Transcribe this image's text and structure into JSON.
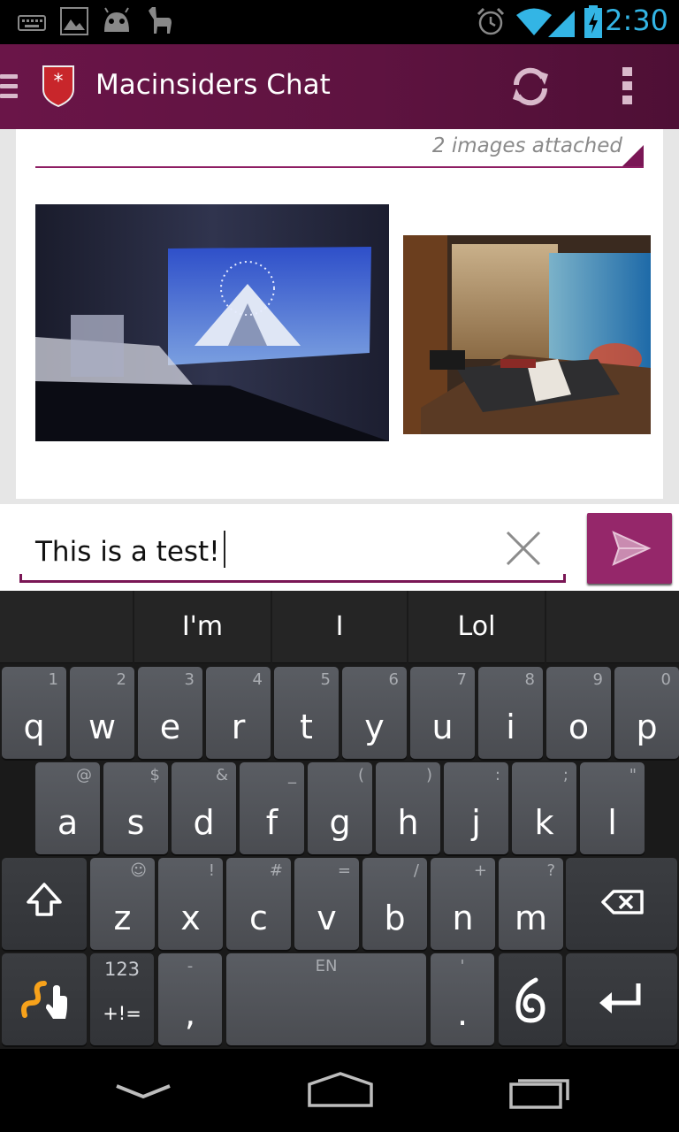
{
  "status_bar": {
    "time": "2:30",
    "icons": [
      "keyboard-icon",
      "image-icon",
      "android-icon",
      "llama-icon",
      "alarm-icon",
      "wifi-icon",
      "signal-icon",
      "battery-icon"
    ],
    "accent": "#33b5e5"
  },
  "action_bar": {
    "title": "Macinsiders Chat",
    "icons": [
      "menu-icon",
      "shield-logo-icon",
      "refresh-icon",
      "overflow-icon"
    ],
    "color": "#6a1548"
  },
  "message": {
    "attachments_label": "2 images attached",
    "images": [
      "home-theater-bedroom-image",
      "aquarium-bedroom-image"
    ]
  },
  "composer": {
    "text": "This is a test!",
    "clear_icon": "close-icon",
    "send_icon": "send-icon",
    "send_color": "#95276a"
  },
  "keyboard": {
    "suggestions": [
      "I'm",
      "I",
      "Lol"
    ],
    "row1": [
      {
        "k": "q",
        "h": "1"
      },
      {
        "k": "w",
        "h": "2"
      },
      {
        "k": "e",
        "h": "3"
      },
      {
        "k": "r",
        "h": "4"
      },
      {
        "k": "t",
        "h": "5"
      },
      {
        "k": "y",
        "h": "6"
      },
      {
        "k": "u",
        "h": "7"
      },
      {
        "k": "i",
        "h": "8"
      },
      {
        "k": "o",
        "h": "9"
      },
      {
        "k": "p",
        "h": "0"
      }
    ],
    "row2": [
      {
        "k": "a",
        "h": "@"
      },
      {
        "k": "s",
        "h": "$"
      },
      {
        "k": "d",
        "h": "&"
      },
      {
        "k": "f",
        "h": "_"
      },
      {
        "k": "g",
        "h": "("
      },
      {
        "k": "h",
        "h": ")"
      },
      {
        "k": "j",
        "h": ":"
      },
      {
        "k": "k",
        "h": ";"
      },
      {
        "k": "l",
        "h": "\""
      }
    ],
    "row3": [
      {
        "k": "z",
        "h": "☺"
      },
      {
        "k": "x",
        "h": "!"
      },
      {
        "k": "c",
        "h": "#"
      },
      {
        "k": "v",
        "h": "="
      },
      {
        "k": "b",
        "h": "/"
      },
      {
        "k": "n",
        "h": "+"
      },
      {
        "k": "m",
        "h": "?"
      }
    ],
    "sym_top": "123",
    "sym_bottom": "+!=",
    "comma": ",",
    "comma_hint": "-",
    "space_label": "EN",
    "period": ".",
    "period_hint": "'"
  },
  "nav_bar": {
    "icons": [
      "back-icon",
      "home-icon",
      "recents-icon"
    ]
  }
}
